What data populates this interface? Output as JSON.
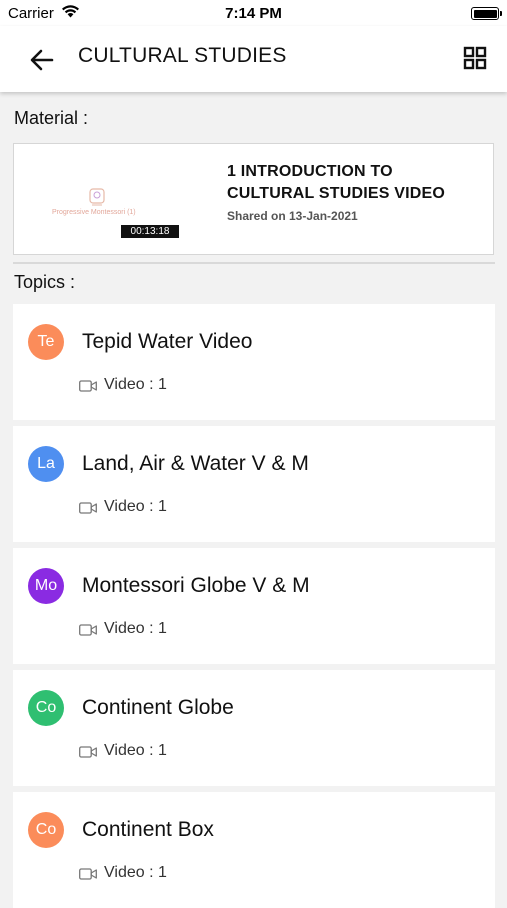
{
  "status_bar": {
    "carrier": "Carrier",
    "time": "7:14 PM"
  },
  "header": {
    "title": "CULTURAL STUDIES"
  },
  "material": {
    "section_label": "Material :",
    "item": {
      "title": "1 INTRODUCTION TO CULTURAL STUDIES VIDEO",
      "shared": "Shared on 13-Jan-2021",
      "duration": "00:13:18",
      "thumbnail_caption": "Progressive Montessori (1)"
    }
  },
  "topics": {
    "section_label": "Topics :",
    "items": [
      {
        "initials": "Te",
        "name": "Tepid Water Video",
        "count": "Video : 1",
        "color": "#fb8c5a"
      },
      {
        "initials": "La",
        "name": "Land, Air & Water V & M",
        "count": "Video : 1",
        "color": "#4f8ff0"
      },
      {
        "initials": "Mo",
        "name": "Montessori Globe V & M",
        "count": "Video : 1",
        "color": "#8a2be2"
      },
      {
        "initials": "Co",
        "name": "Continent Globe",
        "count": "Video : 1",
        "color": "#2fbf71"
      },
      {
        "initials": "Co",
        "name": "Continent Box",
        "count": "Video : 1",
        "color": "#fb8c5a"
      }
    ]
  },
  "icons": [
    "back-arrow-icon",
    "grid-icon",
    "wifi-icon",
    "battery-icon",
    "video-camera-icon"
  ]
}
